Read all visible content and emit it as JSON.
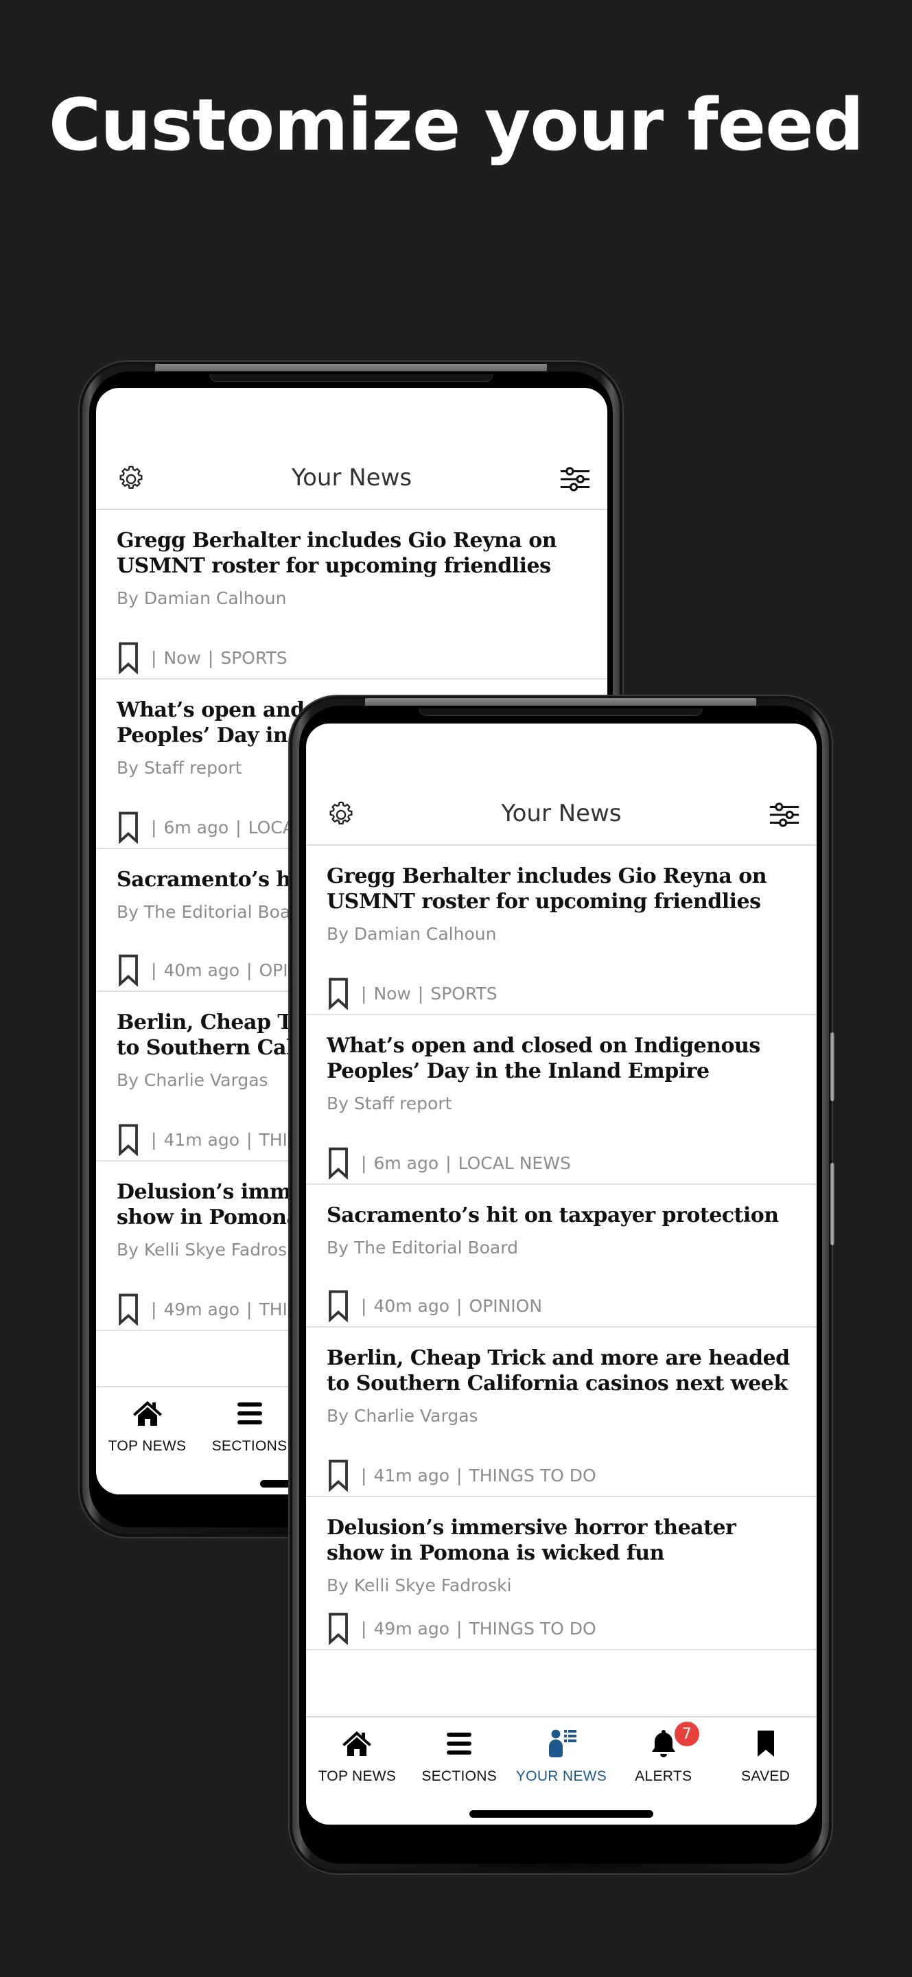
{
  "headline": "Customize your feed",
  "app": {
    "title": "Your News",
    "header_icons": {
      "left": "gear-icon",
      "right": "sliders-icon"
    }
  },
  "articles": [
    {
      "title": "Gregg Berhalter includes Gio Reyna on USMNT roster for upcoming friendlies",
      "byline": "By Damian Calhoun",
      "time": "Now",
      "section": "SPORTS"
    },
    {
      "title": "What’s open and closed on Indigenous Peoples’ Day in the Inland Empire",
      "byline": "By Staff report",
      "time": "6m ago",
      "section": "LOCAL NEWS"
    },
    {
      "title": "Sacramento’s hit on taxpayer protection",
      "byline": "By The Editorial Board",
      "time": "40m ago",
      "section": "OPINION"
    },
    {
      "title": "Berlin, Cheap Trick and more are headed to Southern California casinos next week",
      "byline": "By Charlie Vargas",
      "time": "41m ago",
      "section": "THINGS TO DO"
    },
    {
      "title": "Delusion’s immersive horror theater show in Pomona is wicked fun",
      "byline": "By Kelli Skye Fadroski",
      "time": "49m ago",
      "section": "THINGS TO DO"
    }
  ],
  "meta_separator": "|",
  "tabbar": {
    "tabs": [
      {
        "label": "TOP NEWS",
        "icon": "home-icon",
        "active": false
      },
      {
        "label": "SECTIONS",
        "icon": "menu-icon",
        "active": false
      },
      {
        "label": "YOUR NEWS",
        "icon": "user-list-icon",
        "active": true
      },
      {
        "label": "ALERTS",
        "icon": "bell-icon",
        "active": false,
        "badge": "7"
      },
      {
        "label": "SAVED",
        "icon": "bookmark-icon",
        "active": false
      }
    ]
  },
  "colors": {
    "background": "#1f1e1f",
    "active_tab": "#1c5a8e",
    "badge": "#e8403a",
    "byline": "#8c8c8c"
  }
}
